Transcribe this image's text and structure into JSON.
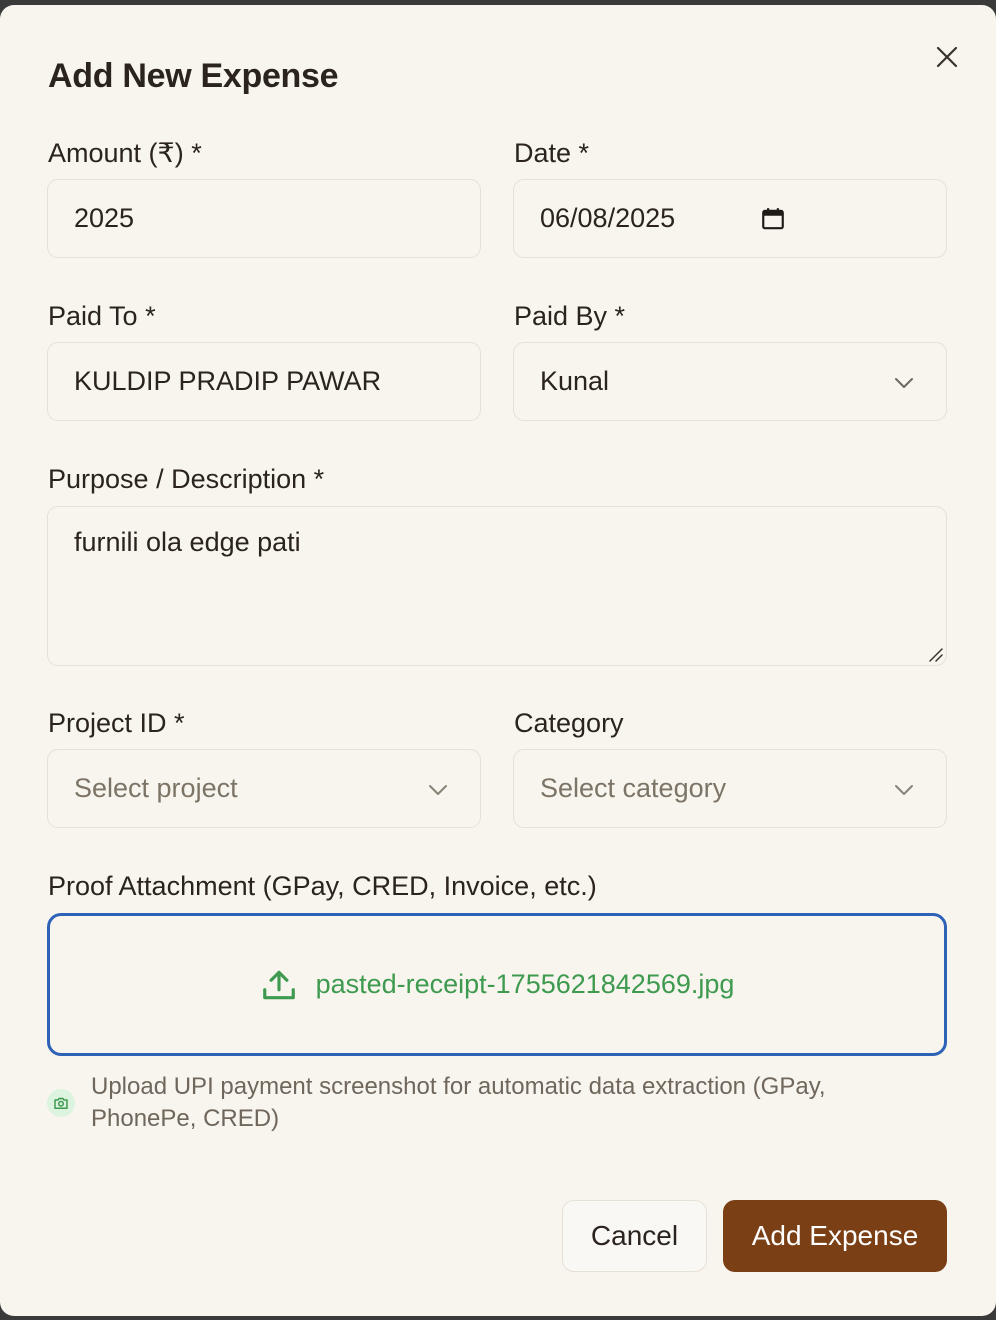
{
  "dialog": {
    "title": "Add New Expense",
    "close_icon": "close-icon"
  },
  "amount": {
    "label": "Amount (₹) *",
    "value": "2025"
  },
  "date": {
    "label": "Date *",
    "value": "06/08/2025",
    "icon": "calendar-icon"
  },
  "paid_to": {
    "label": "Paid To *",
    "value": "KULDIP PRADIP PAWAR"
  },
  "paid_by": {
    "label": "Paid By *",
    "value": "Kunal",
    "icon": "chevron-down-icon"
  },
  "purpose": {
    "label": "Purpose / Description *",
    "value": "furnili ola edge pati"
  },
  "project": {
    "label": "Project ID *",
    "placeholder": "Select project"
  },
  "category": {
    "label": "Category",
    "placeholder": "Select category"
  },
  "attachment": {
    "label": "Proof Attachment (GPay, CRED, Invoice, etc.)",
    "file_name": "pasted-receipt-1755621842569.jpg",
    "icon": "upload-icon",
    "hint": "Upload UPI payment screenshot for automatic data extraction (GPay, PhonePe, CRED)",
    "hint_icon": "camera-icon"
  },
  "actions": {
    "cancel_label": "Cancel",
    "submit_label": "Add Expense"
  },
  "colors": {
    "background": "#f8f5ef",
    "primary_button": "#7a3f15",
    "file_name": "#3e9a4f",
    "focus_border": "#2e62b7"
  }
}
